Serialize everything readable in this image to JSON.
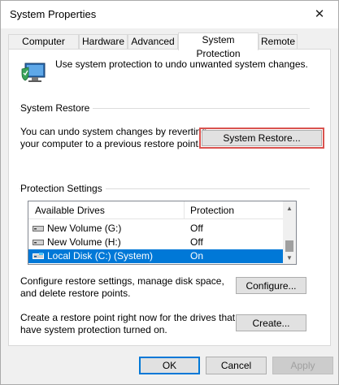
{
  "window": {
    "title": "System Properties",
    "close_glyph": "✕"
  },
  "tabs": [
    {
      "label": "Computer Name"
    },
    {
      "label": "Hardware"
    },
    {
      "label": "Advanced"
    },
    {
      "label": "System Protection"
    },
    {
      "label": "Remote"
    }
  ],
  "active_tab": "System Protection",
  "intro": {
    "text": "Use system protection to undo unwanted system changes.",
    "icon": "computer-shield-icon"
  },
  "system_restore": {
    "group_label": "System Restore",
    "desc_line1": "You can undo system changes by reverting",
    "desc_line2": "your computer to a previous restore point.",
    "button_label": "System Restore..."
  },
  "protection": {
    "group_label": "Protection Settings",
    "columns": [
      "Available Drives",
      "Protection"
    ],
    "rows": [
      {
        "drive": "New Volume (G:)",
        "protection": "Off",
        "selected": false
      },
      {
        "drive": "New Volume (H:)",
        "protection": "Off",
        "selected": false
      },
      {
        "drive": "Local Disk (C:) (System)",
        "protection": "On",
        "selected": true
      }
    ],
    "configure_desc_line1": "Configure restore settings, manage disk space,",
    "configure_desc_line2": "and delete restore points.",
    "configure_label": "Configure...",
    "create_desc_line1": "Create a restore point right now for the drives that",
    "create_desc_line2": "have system protection turned on.",
    "create_label": "Create..."
  },
  "footer": {
    "ok": "OK",
    "cancel": "Cancel",
    "apply": "Apply"
  },
  "colors": {
    "selection": "#0078d7",
    "highlight_border": "#d9534f"
  }
}
